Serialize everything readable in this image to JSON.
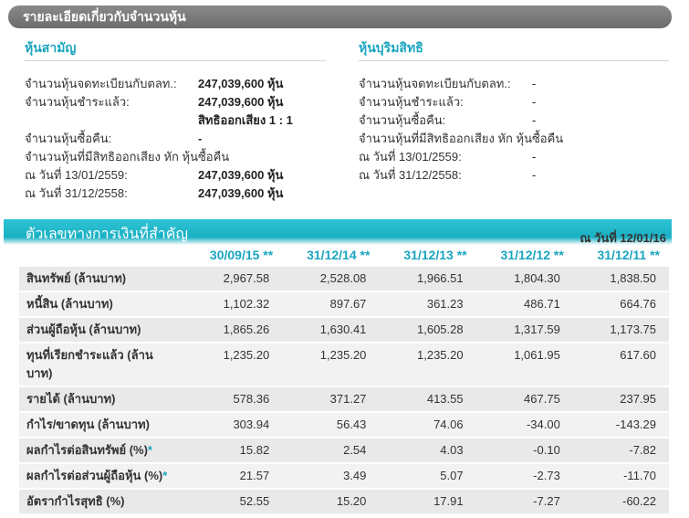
{
  "section": {
    "title": "รายละเอียดเกี่ยวกับจำนวนหุ้น"
  },
  "common": {
    "title": "หุ้นสามัญ",
    "rows": [
      {
        "label": "จำนวนหุ้นจดทะเบียนกับตลท.:",
        "value": "247,039,600 หุ้น"
      },
      {
        "label": "จำนวนหุ้นชำระแล้ว:",
        "value": "247,039,600 หุ้น"
      },
      {
        "label": "",
        "value": "สิทธิออกเสียง 1 : 1"
      },
      {
        "label": "จำนวนหุ้นซื้อคืน:",
        "value": "-"
      },
      {
        "label": "จำนวนหุ้นที่มีสิทธิออกเสียง หัก หุ้นซื้อคืน",
        "value": ""
      },
      {
        "label": "ณ วันที่ 13/01/2559:",
        "value": "247,039,600 หุ้น"
      },
      {
        "label": "ณ วันที่ 31/12/2558:",
        "value": "247,039,600 หุ้น"
      }
    ]
  },
  "preferred": {
    "title": "หุ้นบุริมสิทธิ",
    "rows": [
      {
        "label": "จำนวนหุ้นจดทะเบียนกับตลท.:",
        "value": "-"
      },
      {
        "label": "จำนวนหุ้นชำระแล้ว:",
        "value": "-"
      },
      {
        "label": "จำนวนหุ้นซื้อคืน:",
        "value": "-"
      },
      {
        "label": "จำนวนหุ้นที่มีสิทธิออกเสียง หัก หุ้นซื้อคืน",
        "value": ""
      },
      {
        "label": "ณ วันที่ 13/01/2559:",
        "value": "-"
      },
      {
        "label": "ณ วันที่ 31/12/2558:",
        "value": "-"
      }
    ]
  },
  "financial": {
    "title": "ตัวเลขทางการเงินที่สำคัญ",
    "as_of": "ณ วันที่ 12/01/16",
    "periods": [
      "30/09/15 **",
      "31/12/14 **",
      "31/12/13 **",
      "31/12/12 **",
      "31/12/11 **"
    ],
    "rows": [
      {
        "label": "สินทรัพย์ (ล้านบาท)",
        "star": "",
        "values": [
          "2,967.58",
          "2,528.08",
          "1,966.51",
          "1,804.30",
          "1,838.50"
        ]
      },
      {
        "label": "หนี้สิน (ล้านบาท)",
        "star": "",
        "values": [
          "1,102.32",
          "897.67",
          "361.23",
          "486.71",
          "664.76"
        ]
      },
      {
        "label": "ส่วนผู้ถือหุ้น (ล้านบาท)",
        "star": "",
        "values": [
          "1,865.26",
          "1,630.41",
          "1,605.28",
          "1,317.59",
          "1,173.75"
        ]
      },
      {
        "label": "ทุนที่เรียกชำระแล้ว (ล้านบาท)",
        "star": "",
        "values": [
          "1,235.20",
          "1,235.20",
          "1,235.20",
          "1,061.95",
          "617.60"
        ]
      },
      {
        "label": "รายได้ (ล้านบาท)",
        "star": "",
        "values": [
          "578.36",
          "371.27",
          "413.55",
          "467.75",
          "237.95"
        ]
      },
      {
        "label": "กำไร/ขาดทุน (ล้านบาท)",
        "star": "",
        "values": [
          "303.94",
          "56.43",
          "74.06",
          "-34.00",
          "-143.29"
        ]
      },
      {
        "label": "ผลกำไรต่อสินทรัพย์ (%)",
        "star": "*",
        "values": [
          "15.82",
          "2.54",
          "4.03",
          "-0.10",
          "-7.82"
        ]
      },
      {
        "label": "ผลกำไรต่อส่วนผู้ถือหุ้น (%)",
        "star": "*",
        "values": [
          "21.57",
          "3.49",
          "5.07",
          "-2.73",
          "-11.70"
        ]
      },
      {
        "label": "อัตรากำไรสุทธิ (%)",
        "star": "",
        "values": [
          "52.55",
          "15.20",
          "17.91",
          "-7.27",
          "-60.22"
        ]
      }
    ]
  }
}
